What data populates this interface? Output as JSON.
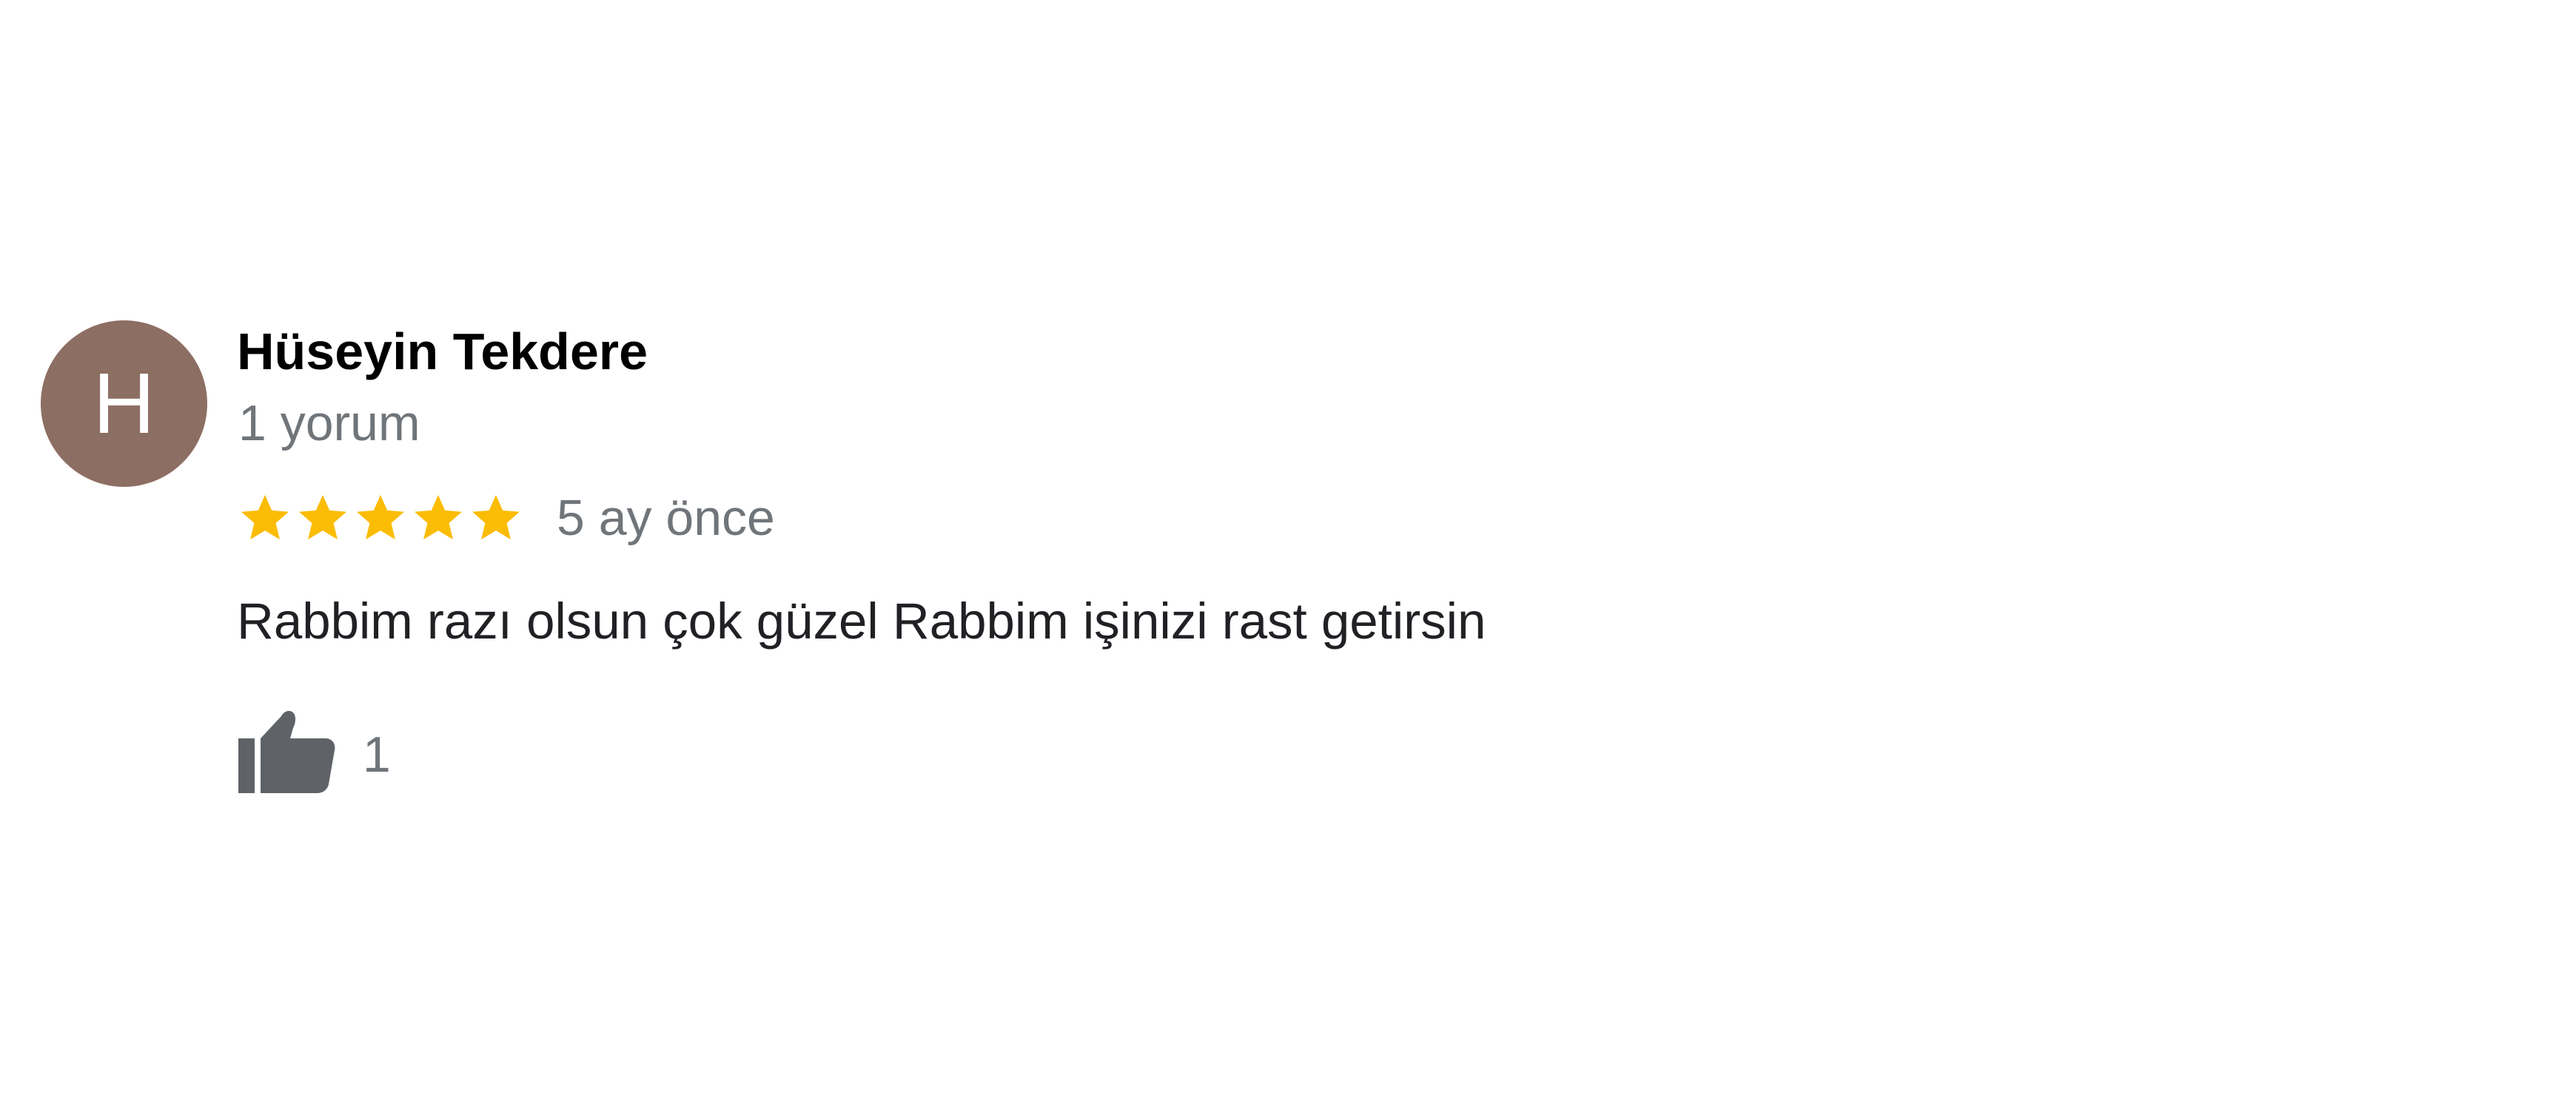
{
  "review": {
    "avatar_letter": "H",
    "avatar_color": "#8d6e63",
    "author_name": "Hüseyin Tekdere",
    "review_count": "1 yorum",
    "rating": 5,
    "rating_max": 5,
    "star_color": "#fbbc04",
    "star_icon": "star-icon",
    "date": "5 ay önce",
    "text": "Rabbim razı olsun çok güzel Rabbim işinizi rast getirsin",
    "like_icon": "thumbs-up-icon",
    "like_count": "1"
  }
}
